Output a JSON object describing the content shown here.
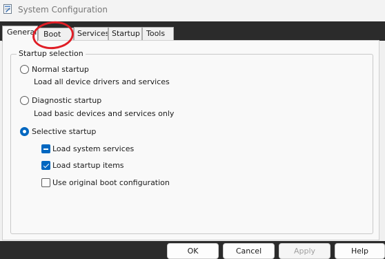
{
  "window": {
    "title": "System Configuration",
    "icon": "msconfig-icon"
  },
  "tabs": [
    {
      "label": "General",
      "active": true
    },
    {
      "label": "Boot",
      "active": false,
      "highlighted": true
    },
    {
      "label": "Services",
      "active": false
    },
    {
      "label": "Startup",
      "active": false
    },
    {
      "label": "Tools",
      "active": false
    }
  ],
  "group": {
    "title": "Startup selection"
  },
  "options": {
    "normal": {
      "label": "Normal startup",
      "description": "Load all device drivers and services",
      "selected": false
    },
    "diagnostic": {
      "label": "Diagnostic startup",
      "description": "Load basic devices and services only",
      "selected": false
    },
    "selective": {
      "label": "Selective startup",
      "selected": true
    }
  },
  "selective_items": {
    "system_services": {
      "label": "Load system services",
      "state": "indeterminate"
    },
    "startup_items": {
      "label": "Load startup items",
      "state": "checked"
    },
    "original_boot": {
      "label": "Use original boot configuration",
      "state": "unchecked"
    }
  },
  "buttons": {
    "ok": "OK",
    "cancel": "Cancel",
    "apply": "Apply",
    "help": "Help"
  },
  "colors": {
    "accent": "#0067c0",
    "highlight_ring": "#e01e26",
    "background": "#2b2b2b"
  }
}
